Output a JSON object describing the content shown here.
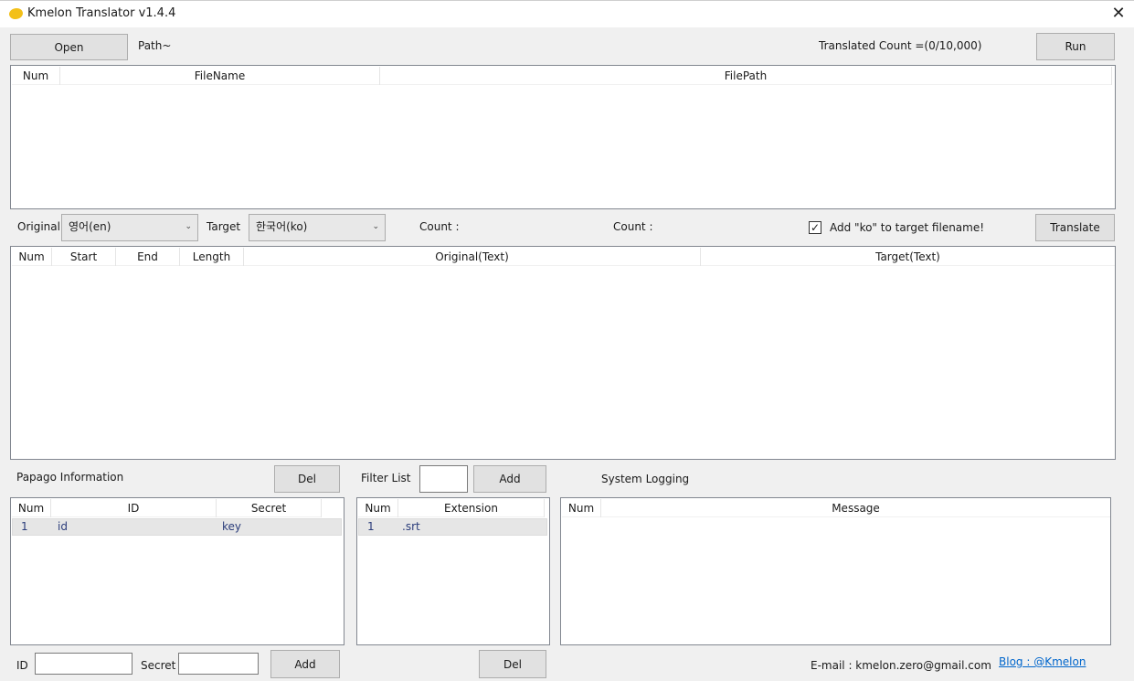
{
  "window": {
    "title": "Kmelon Translator v1.4.4",
    "close_glyph": "✕"
  },
  "top": {
    "open_label": "Open",
    "path_label": "Path~",
    "translated_count": "Translated Count =(0/10,000)",
    "run_label": "Run"
  },
  "files_table": {
    "columns": [
      "Num",
      "FileName",
      "FilePath"
    ]
  },
  "language": {
    "original_label": "Original",
    "original_value": "영어(en)",
    "target_label": "Target",
    "target_value": "한국어(ko)",
    "count_label_1": "Count :",
    "count_label_2": "Count :",
    "checkbox_checked": true,
    "checkbox_label": "Add \"ko\" to target filename!",
    "translate_label": "Translate"
  },
  "subtitle_table": {
    "columns": [
      "Num",
      "Start",
      "End",
      "Length",
      "Original(Text)",
      "Target(Text)"
    ]
  },
  "papago": {
    "section_label": "Papago Information",
    "del_label": "Del",
    "columns": [
      "Num",
      "ID",
      "Secret"
    ],
    "rows": [
      {
        "num": "1",
        "id": "id",
        "secret": "key"
      }
    ],
    "id_label": "ID",
    "secret_label": "Secret",
    "add_label": "Add"
  },
  "filter": {
    "section_label": "Filter List",
    "add_label": "Add",
    "columns": [
      "Num",
      "Extension"
    ],
    "rows": [
      {
        "num": "1",
        "ext": ".srt"
      }
    ],
    "del_label": "Del"
  },
  "logging": {
    "section_label": "System Logging",
    "columns": [
      "Num",
      "Message"
    ]
  },
  "footer": {
    "email": "E-mail : kmelon.zero@gmail.com",
    "blog": "Blog : @Kmelon"
  },
  "colors": {
    "background": "#f0f0f0",
    "button": "#e1e1e1",
    "selected_row": "#e6e6e6",
    "link": "#0066cc"
  },
  "icons": {
    "app": "melon-icon",
    "checkbox": "checkmark-icon",
    "dropdown": "chevron-down-icon"
  }
}
